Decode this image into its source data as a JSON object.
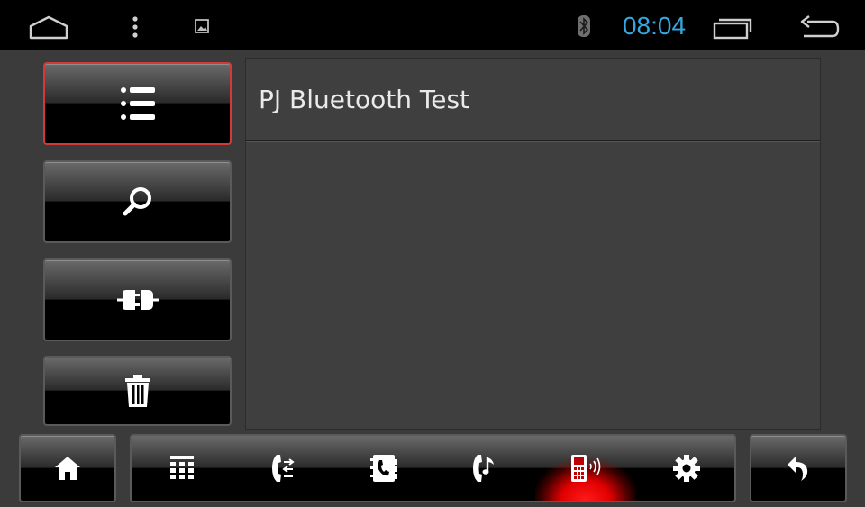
{
  "status_bar": {
    "time": "08:04",
    "time_color": "#35a8df",
    "icons": [
      "home-outline-icon",
      "overflow-menu-icon",
      "gallery-icon",
      "bluetooth-icon",
      "recent-apps-icon",
      "back-arrow-icon"
    ]
  },
  "sidebar": {
    "buttons": [
      {
        "name": "paired-list",
        "icon": "list-icon",
        "active": true
      },
      {
        "name": "search",
        "icon": "search-icon",
        "active": false
      },
      {
        "name": "connect",
        "icon": "plug-icon",
        "active": false
      },
      {
        "name": "delete",
        "icon": "trash-icon",
        "active": false
      }
    ]
  },
  "devices": [
    {
      "name": "PJ Bluetooth Test"
    }
  ],
  "bottom_bar": {
    "tabs": [
      {
        "name": "dialpad",
        "icon": "dialpad-icon",
        "active": false
      },
      {
        "name": "call-log",
        "icon": "call-log-icon",
        "active": false
      },
      {
        "name": "contacts",
        "icon": "contacts-icon",
        "active": false
      },
      {
        "name": "music",
        "icon": "bt-music-icon",
        "active": false
      },
      {
        "name": "device",
        "icon": "phone-signal-icon",
        "active": true
      },
      {
        "name": "settings",
        "icon": "gear-icon",
        "active": false
      }
    ],
    "active_color": "#e10000"
  }
}
